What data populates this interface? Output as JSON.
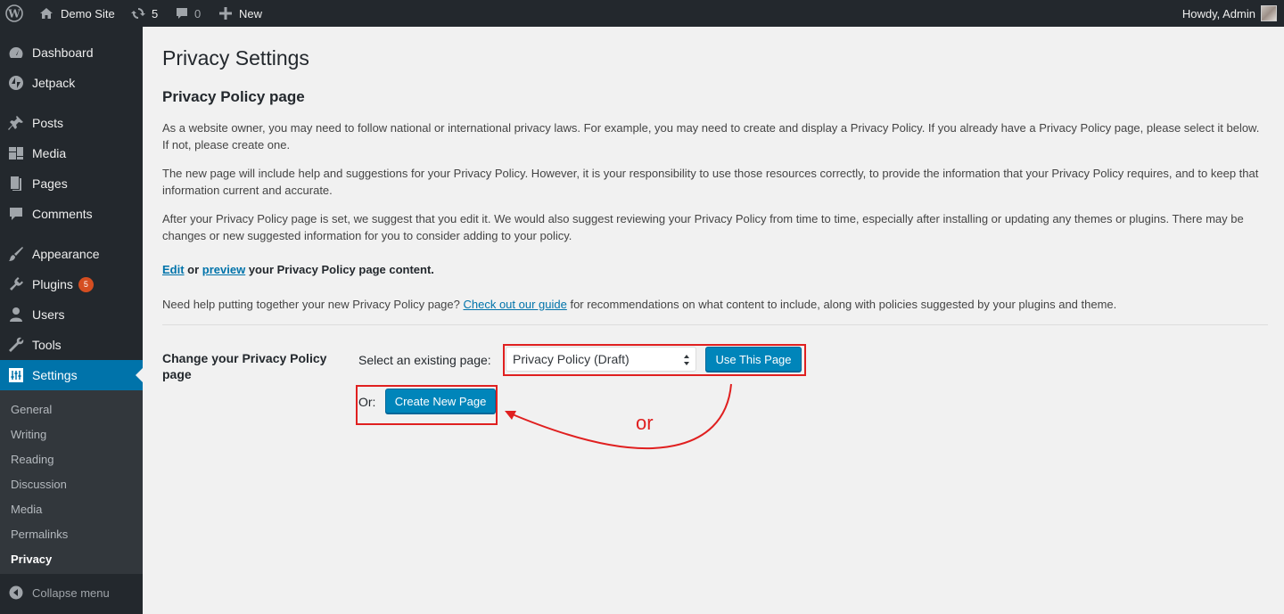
{
  "adminbar": {
    "site_name": "Demo Site",
    "updates_count": "5",
    "comments_count": "0",
    "new_label": "New",
    "howdy": "Howdy, Admin"
  },
  "sidebar": {
    "items": [
      {
        "label": "Dashboard",
        "icon": "dashboard-icon"
      },
      {
        "label": "Jetpack",
        "icon": "jetpack-icon"
      },
      {
        "label": "Posts",
        "icon": "pushpin-icon"
      },
      {
        "label": "Media",
        "icon": "media-icon"
      },
      {
        "label": "Pages",
        "icon": "pages-icon"
      },
      {
        "label": "Comments",
        "icon": "comment-icon"
      },
      {
        "label": "Appearance",
        "icon": "paintbrush-icon"
      },
      {
        "label": "Plugins",
        "icon": "plugin-icon",
        "badge": "5"
      },
      {
        "label": "Users",
        "icon": "users-icon"
      },
      {
        "label": "Tools",
        "icon": "wrench-icon"
      },
      {
        "label": "Settings",
        "icon": "settings-icon"
      }
    ],
    "submenu": [
      "General",
      "Writing",
      "Reading",
      "Discussion",
      "Media",
      "Permalinks",
      "Privacy"
    ],
    "collapse_label": "Collapse menu"
  },
  "main": {
    "title": "Privacy Settings",
    "section_title": "Privacy Policy page",
    "para1": "As a website owner, you may need to follow national or international privacy laws. For example, you may need to create and display a Privacy Policy. If you already have a Privacy Policy page, please select it below. If not, please create one.",
    "para2": "The new page will include help and suggestions for your Privacy Policy. However, it is your responsibility to use those resources correctly, to provide the information that your Privacy Policy requires, and to keep that information current and accurate.",
    "para3": "After your Privacy Policy page is set, we suggest that you edit it. We would also suggest reviewing your Privacy Policy from time to time, especially after installing or updating any themes or plugins. There may be changes or new suggested information for you to consider adding to your policy.",
    "edit_link": "Edit",
    "or_word": " or ",
    "preview_link": "preview",
    "edit_suffix": " your Privacy Policy page content.",
    "help_prefix": "Need help putting together your new Privacy Policy page? ",
    "guide_link": "Check out our guide",
    "help_suffix": " for recommendations on what content to include, along with policies suggested by your plugins and theme.",
    "row_label": "Change your Privacy Policy page",
    "select_label": "Select an existing page:",
    "select_value": "Privacy Policy (Draft)",
    "use_button": "Use This Page",
    "or_label": "Or:",
    "create_button": "Create New Page",
    "annotation_or": "or"
  },
  "colors": {
    "accent": "#0073aa",
    "button": "#0085ba",
    "annotation": "#e02020",
    "adminbar": "#23282d",
    "badge": "#d54e21"
  }
}
